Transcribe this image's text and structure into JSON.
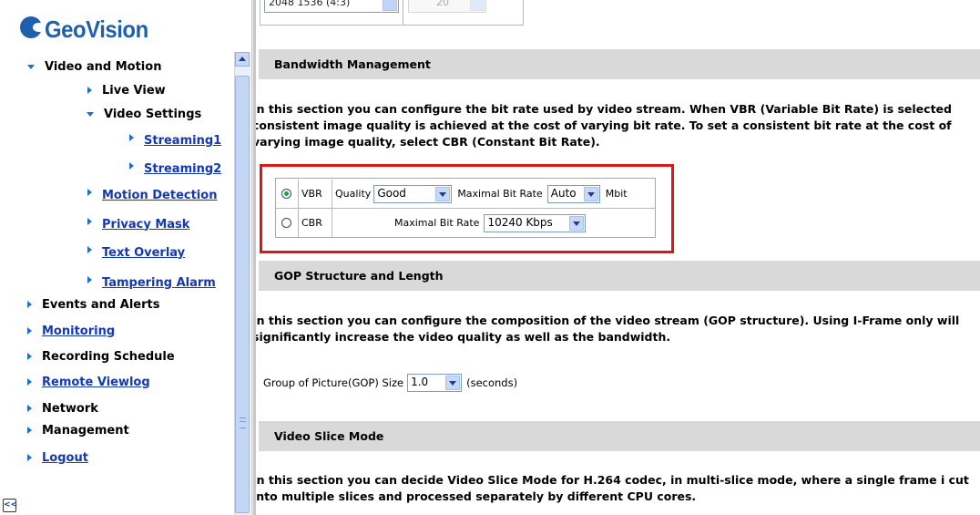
{
  "sidebar": {
    "logo_text": "GeoVision",
    "items": [
      {
        "label": "Video and Motion",
        "link": false,
        "expanded": true
      },
      {
        "label": "Live View",
        "link": false
      },
      {
        "label": "Video Settings",
        "link": false,
        "expanded": true
      },
      {
        "label": "Streaming1",
        "link": true
      },
      {
        "label": "Streaming2",
        "link": true
      },
      {
        "label": "Motion Detection",
        "link": true
      },
      {
        "label": "Privacy Mask",
        "link": true
      },
      {
        "label": "Text Overlay",
        "link": true
      },
      {
        "label": "Tampering Alarm",
        "link": true
      },
      {
        "label": "Events and Alerts",
        "link": false
      },
      {
        "label": "Monitoring",
        "link": true
      },
      {
        "label": "Recording Schedule",
        "link": false
      },
      {
        "label": "Remote Viewlog",
        "link": true
      },
      {
        "label": "Network",
        "link": false
      },
      {
        "label": "Management",
        "link": false
      },
      {
        "label": "Logout",
        "link": true
      }
    ],
    "collapse_label": "<<"
  },
  "content": {
    "resolution_value": "2048 1536 (4:3)",
    "fps_value": "20",
    "bandwidth": {
      "title": "Bandwidth Management",
      "description": "In this section you can configure the bit rate used by video stream. When VBR (Variable Bit Rate) is selected consistent image quality is achieved at the cost of varying bit rate. To set a consistent bit rate at the cost of varying image quality, select CBR (Constant Bit Rate).",
      "vbr_label": "VBR",
      "quality_label": "Quality",
      "quality_value": "Good",
      "vbr_max_label": "Maximal Bit Rate",
      "vbr_max_value": "Auto",
      "vbr_unit": "Mbit",
      "cbr_label": "CBR",
      "cbr_max_label": "Maximal Bit Rate",
      "cbr_max_value": "10240 Kbps",
      "selected_mode": "VBR"
    },
    "gop": {
      "title": "GOP Structure and Length",
      "description": "In this section you can configure the composition of the video stream (GOP structure). Using I-Frame only will significantly increase the video quality as well as the bandwidth.",
      "size_label": "Group of Picture(GOP) Size",
      "size_value": "1.0",
      "unit": "(seconds)"
    },
    "slice": {
      "title": "Video Slice Mode",
      "description": "In this section you can decide Video Slice Mode for H.264 codec, in multi-slice mode, where a single frame i cut into multiple slices and processed separately by different CPU cores."
    }
  }
}
